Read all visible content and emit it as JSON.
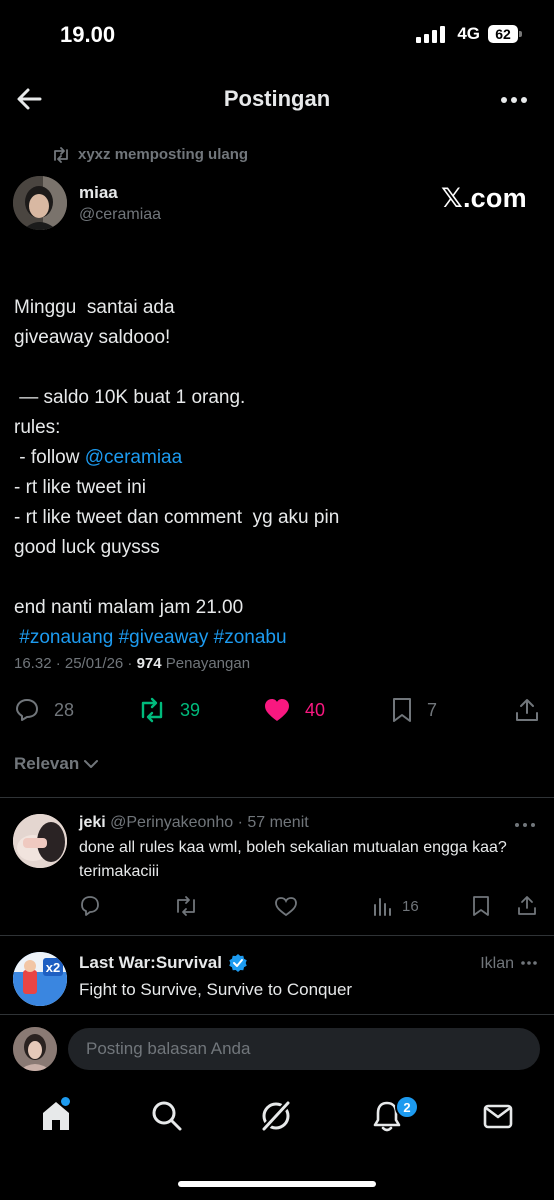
{
  "status": {
    "time": "19.00",
    "network": "4G",
    "battery": "62"
  },
  "header": {
    "title": "Postingan"
  },
  "repost": {
    "text": "xyxz memposting ulang"
  },
  "post": {
    "name": "miaa",
    "handle": "@ceramiaa",
    "watermark": "𝕏.com",
    "lines": [
      "Minggu  santai ada",
      "giveaway saldooo!",
      "",
      " — saldo 10K buat 1 orang.",
      "rules:",
      " - follow ",
      "- rt like tweet ini",
      "- rt like tweet dan comment  yg aku pin",
      "good luck guysss",
      "",
      "end nanti malam jam 21.00"
    ],
    "mention": "@ceramiaa",
    "hashtags": " #zonauang #giveaway #zonabu",
    "timestamp": "16.32 · 25/01/26 · ",
    "views": "974",
    "views_label": " Penayangan",
    "stats": {
      "replies": "28",
      "reposts": "39",
      "likes": "40",
      "bookmarks": "7"
    }
  },
  "sort": {
    "label": "Relevan"
  },
  "reply": {
    "name": "jeki",
    "handle": " @Perinyakeonho · 57 menit",
    "text": "done all rules kaa wml, boleh sekalian mutualan engga kaa? terimakaciii",
    "views": "16"
  },
  "ad": {
    "name": "Last War:Survival",
    "label": "Iklan",
    "text": "Fight to Survive, Survive to Conquer",
    "avatar_text": "x2"
  },
  "compose": {
    "placeholder": "Posting balasan Anda"
  },
  "nav": {
    "notifications_badge": "2"
  },
  "colors": {
    "accent": "#1d9bf0",
    "repost": "#00ba7c",
    "like": "#f91880",
    "muted": "#71767b"
  }
}
